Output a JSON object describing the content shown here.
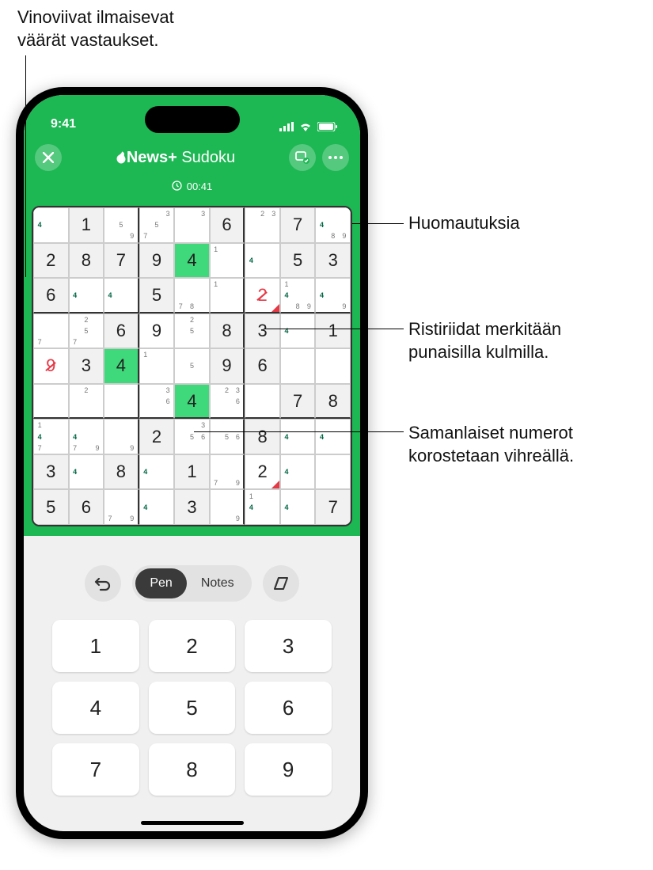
{
  "callouts": {
    "top": "Vinoviivat ilmaisevat\nväärät vastaukset.",
    "c1": "Huomautuksia",
    "c2": "Ristiriidat merkitään\npunaisilla kulmilla.",
    "c3": "Samanlaiset numerot\nkorostetaan vihreällä."
  },
  "status": {
    "time": "9:41"
  },
  "header": {
    "brand": "News+",
    "game": "Sudoku"
  },
  "timer": {
    "value": "00:41"
  },
  "controls": {
    "pen": "Pen",
    "notes": "Notes"
  },
  "keypad": [
    "1",
    "2",
    "3",
    "4",
    "5",
    "6",
    "7",
    "8",
    "9"
  ],
  "sudoku": {
    "rows": [
      [
        {
          "notes": [
            "",
            "",
            "",
            "4",
            "",
            "",
            "",
            "",
            ""
          ]
        },
        {
          "val": "1",
          "given": true
        },
        {
          "notes": [
            "",
            "",
            "",
            "",
            "5",
            "",
            "",
            "",
            "9"
          ]
        },
        {
          "notes": [
            "",
            "",
            "3",
            "",
            "5",
            "",
            "7",
            "",
            ""
          ]
        },
        {
          "notes": [
            "",
            "",
            "3",
            "",
            "",
            "",
            "",
            "",
            ""
          ]
        },
        {
          "val": "6",
          "given": true
        },
        {
          "notes": [
            "",
            "2",
            "3",
            "",
            "",
            "",
            "",
            "",
            ""
          ]
        },
        {
          "val": "7",
          "given": true
        },
        {
          "notes": [
            "",
            "",
            "",
            "4",
            "",
            "",
            "",
            "8",
            "9"
          ]
        },
        {
          "notes": [
            "",
            "",
            "",
            "4",
            "",
            "",
            "",
            "",
            "9"
          ]
        }
      ],
      [
        {
          "val": "2",
          "given": true
        },
        {
          "val": "8",
          "given": true
        },
        {
          "val": "7",
          "given": true
        },
        {
          "val": "9",
          "given": true
        },
        {
          "val": "4",
          "hl": true
        },
        {
          "notes": [
            "1",
            "",
            "",
            "",
            "",
            "",
            "",
            "",
            ""
          ]
        },
        {
          "notes": [
            "",
            "",
            "",
            "4",
            "",
            "",
            "",
            "",
            ""
          ]
        },
        {
          "val": "5",
          "given": true
        },
        {
          "val": "3",
          "given": true
        }
      ],
      [
        {
          "val": "6",
          "given": true
        },
        {
          "notes": [
            "",
            "",
            "",
            "4",
            "",
            "",
            "",
            "",
            ""
          ]
        },
        {
          "notes": [
            "",
            "",
            "",
            "4",
            "",
            "",
            "",
            "",
            ""
          ]
        },
        {
          "val": "5",
          "given": true
        },
        {
          "notes": [
            "",
            "",
            "",
            "",
            "",
            "",
            "7",
            "8",
            ""
          ]
        },
        {
          "notes": [
            "1",
            "",
            "",
            "",
            "",
            "",
            "",
            "",
            ""
          ]
        },
        {
          "val": "2",
          "wrong": true,
          "conflict": true
        },
        {
          "notes": [
            "1",
            "",
            "",
            "4",
            "",
            "",
            "",
            "8",
            "9"
          ]
        },
        {
          "notes": [
            "",
            "",
            "",
            "4",
            "",
            "",
            "",
            "",
            "9"
          ]
        }
      ],
      [
        {
          "notes": [
            "",
            "",
            "",
            "",
            "",
            "",
            "7",
            "",
            ""
          ]
        },
        {
          "notes": [
            "",
            "2",
            "",
            "",
            "5",
            "",
            "7",
            "",
            ""
          ]
        },
        {
          "val": "6",
          "given": true
        },
        {
          "val": "9"
        },
        {
          "notes": [
            "",
            "2",
            "",
            "",
            "5",
            "",
            "",
            "",
            ""
          ]
        },
        {
          "val": "8",
          "given": true
        },
        {
          "val": "3",
          "given": true
        },
        {
          "notes": [
            "",
            "",
            "",
            "4",
            "",
            "",
            "",
            "",
            ""
          ]
        },
        {
          "val": "1",
          "given": true
        }
      ],
      [
        {
          "val": "9",
          "wrong": true
        },
        {
          "val": "3",
          "given": true
        },
        {
          "val": "4",
          "hl": true
        },
        {
          "notes": [
            "1",
            "",
            "",
            "",
            "",
            "",
            "",
            "",
            ""
          ]
        },
        {
          "notes": [
            "",
            "",
            "",
            "",
            "5",
            "",
            "",
            "",
            ""
          ]
        },
        {
          "val": "9",
          "given": true
        },
        {
          "val": "6",
          "given": true
        },
        {
          "notes": [
            "",
            "",
            "",
            "",
            "",
            "",
            "",
            "",
            ""
          ]
        },
        {
          "notes": [
            "",
            "",
            "",
            "",
            "",
            "",
            "",
            "",
            ""
          ]
        }
      ],
      [
        {
          "notes": [
            "",
            "",
            "",
            "",
            "",
            "",
            "",
            "",
            ""
          ]
        },
        {
          "notes": [
            "",
            "2",
            "",
            "",
            "",
            "",
            "",
            "",
            ""
          ]
        },
        {
          "notes": [
            "",
            "",
            "",
            "",
            "",
            "",
            "",
            "",
            ""
          ]
        },
        {
          "notes": [
            "",
            "",
            "3",
            "",
            "",
            "6",
            "",
            "",
            ""
          ]
        },
        {
          "val": "4",
          "hl": true
        },
        {
          "notes": [
            "",
            "2",
            "3",
            "",
            "",
            "6",
            "",
            "",
            ""
          ]
        },
        {
          "notes": [
            "",
            "",
            "",
            "",
            "",
            "",
            "",
            "",
            ""
          ]
        },
        {
          "val": "7",
          "given": true
        },
        {
          "val": "8",
          "given": true
        }
      ],
      [
        {
          "notes": [
            "1",
            "",
            "",
            "4",
            "",
            "",
            "7",
            "",
            ""
          ]
        },
        {
          "notes": [
            "",
            "",
            "",
            "4",
            "",
            "",
            "7",
            "",
            "9"
          ]
        },
        {
          "notes": [
            "",
            "",
            "",
            "",
            "",
            "",
            "",
            "",
            "9"
          ]
        },
        {
          "val": "2",
          "given": true
        },
        {
          "notes": [
            "",
            "",
            "3",
            "",
            "5",
            "6",
            "",
            "",
            ""
          ]
        },
        {
          "notes": [
            "",
            "",
            "",
            "",
            "5",
            "6",
            "",
            "",
            ""
          ]
        },
        {
          "val": "8",
          "given": true
        },
        {
          "notes": [
            "",
            "",
            "",
            "4",
            "",
            "",
            "",
            "",
            ""
          ]
        },
        {
          "notes": [
            "",
            "",
            "",
            "4",
            "",
            "",
            "",
            "",
            ""
          ]
        }
      ],
      [
        {
          "val": "3",
          "given": true
        },
        {
          "notes": [
            "",
            "",
            "",
            "4",
            "",
            "",
            "",
            "",
            ""
          ]
        },
        {
          "val": "8",
          "given": true
        },
        {
          "notes": [
            "",
            "",
            "",
            "4",
            "",
            "",
            "",
            "",
            ""
          ]
        },
        {
          "val": "1",
          "given": true
        },
        {
          "notes": [
            "",
            "",
            "",
            "",
            "",
            "",
            "7",
            "",
            "9"
          ]
        },
        {
          "val": "2",
          "conflict": true
        },
        {
          "notes": [
            "",
            "",
            "",
            "4",
            "",
            "",
            "",
            "",
            ""
          ]
        },
        {
          "notes": [
            "",
            "",
            "",
            "",
            "",
            "",
            "",
            "",
            ""
          ]
        }
      ],
      [
        {
          "val": "5",
          "given": true
        },
        {
          "val": "6",
          "given": true
        },
        {
          "notes": [
            "",
            "",
            "",
            "",
            "",
            "",
            "7",
            "",
            "9"
          ]
        },
        {
          "notes": [
            "",
            "",
            "",
            "4",
            "",
            "",
            "",
            "",
            ""
          ]
        },
        {
          "val": "3",
          "given": true
        },
        {
          "notes": [
            "",
            "",
            "",
            "",
            "",
            "",
            "",
            "",
            "9"
          ]
        },
        {
          "notes": [
            "1",
            "",
            "",
            "4",
            "",
            "",
            "",
            "",
            ""
          ]
        },
        {
          "notes": [
            "",
            "",
            "",
            "4",
            "",
            "",
            "",
            "",
            ""
          ]
        },
        {
          "val": "7",
          "given": true
        }
      ]
    ]
  }
}
